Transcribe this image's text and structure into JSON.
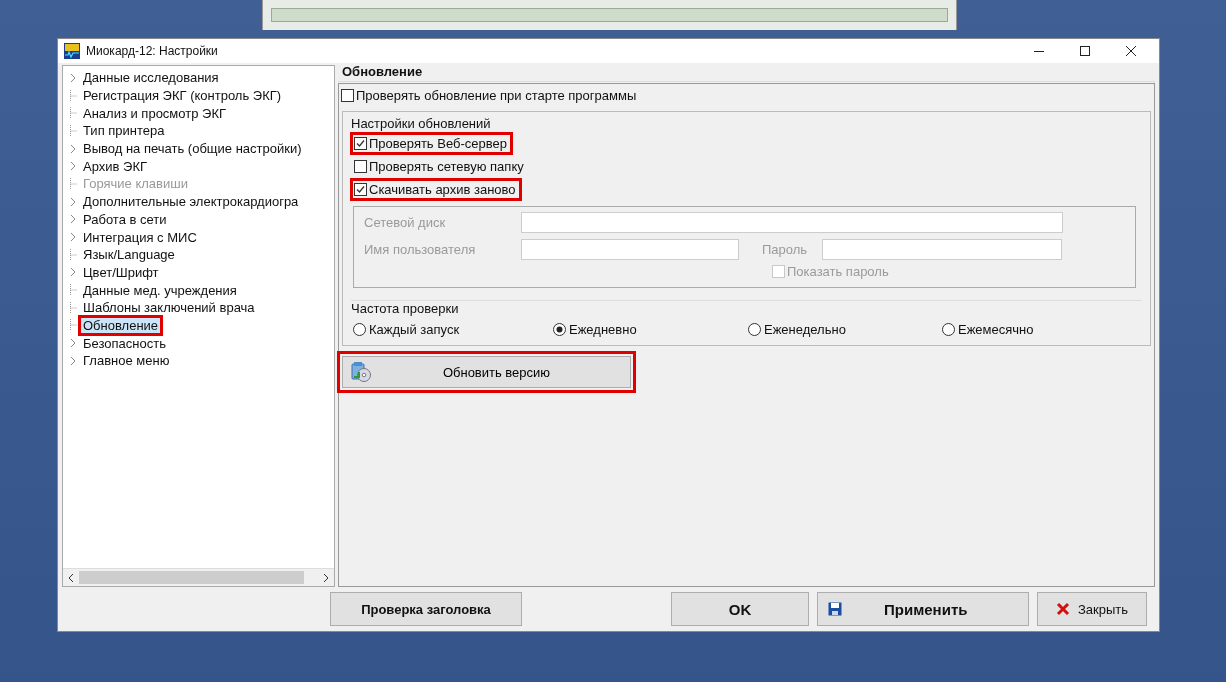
{
  "window": {
    "title": "Миокард-12: Настройки"
  },
  "tree": [
    {
      "label": "Данные исследования",
      "expandable": true,
      "selected": false,
      "disabled": false,
      "highlighted": false
    },
    {
      "label": "Регистрация ЭКГ (контроль ЭКГ)",
      "expandable": false,
      "selected": false,
      "disabled": false,
      "highlighted": false
    },
    {
      "label": "Анализ и просмотр ЭКГ",
      "expandable": false,
      "selected": false,
      "disabled": false,
      "highlighted": false
    },
    {
      "label": "Тип принтера",
      "expandable": false,
      "selected": false,
      "disabled": false,
      "highlighted": false
    },
    {
      "label": "Вывод на печать (общие настройки)",
      "expandable": true,
      "selected": false,
      "disabled": false,
      "highlighted": false
    },
    {
      "label": "Архив ЭКГ",
      "expandable": true,
      "selected": false,
      "disabled": false,
      "highlighted": false
    },
    {
      "label": "Горячие клавиши",
      "expandable": false,
      "selected": false,
      "disabled": true,
      "highlighted": false
    },
    {
      "label": "Дополнительные электрокардиогра",
      "expandable": true,
      "selected": false,
      "disabled": false,
      "highlighted": false
    },
    {
      "label": "Работа в сети",
      "expandable": true,
      "selected": false,
      "disabled": false,
      "highlighted": false
    },
    {
      "label": "Интеграция с МИС",
      "expandable": true,
      "selected": false,
      "disabled": false,
      "highlighted": false
    },
    {
      "label": "Язык/Language",
      "expandable": false,
      "selected": false,
      "disabled": false,
      "highlighted": false
    },
    {
      "label": "Цвет/Шрифт",
      "expandable": true,
      "selected": false,
      "disabled": false,
      "highlighted": false
    },
    {
      "label": "Данные мед. учреждения",
      "expandable": false,
      "selected": false,
      "disabled": false,
      "highlighted": false
    },
    {
      "label": "Шаблоны заключений врача",
      "expandable": false,
      "selected": false,
      "disabled": false,
      "highlighted": false
    },
    {
      "label": "Обновление",
      "expandable": false,
      "selected": true,
      "disabled": false,
      "highlighted": true
    },
    {
      "label": "Безопасность",
      "expandable": true,
      "selected": false,
      "disabled": false,
      "highlighted": false
    },
    {
      "label": "Главное меню",
      "expandable": true,
      "selected": false,
      "disabled": false,
      "highlighted": false
    }
  ],
  "panel": {
    "title": "Обновление",
    "check_on_start": {
      "label": "Проверять обновление при старте программы",
      "checked": false
    },
    "update_settings": {
      "title": "Настройки обновлений",
      "options": [
        {
          "label": "Проверять Веб-сервер",
          "checked": true,
          "highlighted": true
        },
        {
          "label": "Проверять сетевую папку",
          "checked": false,
          "highlighted": false
        },
        {
          "label": "Скачивать архив заново",
          "checked": true,
          "highlighted": true
        }
      ],
      "network": {
        "disabled": true,
        "network_drive": {
          "label": "Сетевой диск"
        },
        "username": {
          "label": "Имя пользователя"
        },
        "password": {
          "label": "Пароль"
        },
        "show_password": {
          "label": "Показать пароль",
          "checked": false
        }
      },
      "frequency": {
        "title": "Частота проверки",
        "options": [
          {
            "label": "Каждый запуск",
            "selected": false
          },
          {
            "label": "Ежедневно",
            "selected": true
          },
          {
            "label": "Еженедельно",
            "selected": false
          },
          {
            "label": "Ежемесячно",
            "selected": false
          }
        ]
      }
    },
    "update_button": {
      "label": "Обновить версию",
      "highlighted": true
    }
  },
  "buttons": [
    {
      "label": "Проверка заголовка",
      "kind": "plain"
    },
    {
      "label": "OK",
      "kind": "ok"
    },
    {
      "label": "Применить",
      "kind": "save"
    },
    {
      "label": "Закрыть",
      "kind": "close"
    }
  ]
}
